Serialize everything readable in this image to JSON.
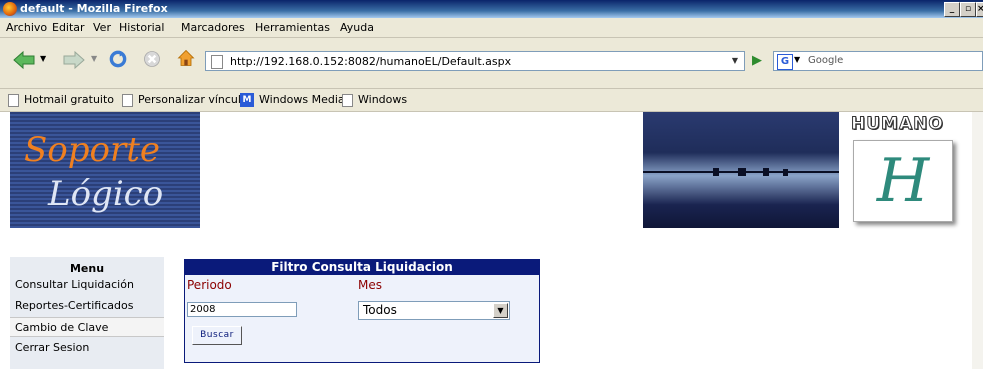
{
  "window": {
    "title": "default - Mozilla Firefox"
  },
  "menubar": [
    "Archivo",
    "Editar",
    "Ver",
    "Historial",
    "Marcadores",
    "Herramientas",
    "Ayuda"
  ],
  "navigation": {
    "url": "http://192.168.0.152:8082/humanoEL/Default.aspx",
    "search_placeholder": "Google"
  },
  "bookmarks": [
    "Hotmail gratuito",
    "Personalizar vínculos",
    "Windows Media",
    "Windows"
  ],
  "banner": {
    "logo_line1": "Soporte",
    "logo_line2": "Lógico",
    "brand": "HUMANO",
    "brand_mark": "H"
  },
  "sidebar": {
    "title": "Menu",
    "items": [
      "Consultar Liquidación",
      "Reportes-Certificados",
      "Cambio de Clave",
      "Cerrar Sesion"
    ]
  },
  "filter": {
    "title": "Filtro Consulta Liquidacion",
    "periodo_label": "Periodo",
    "periodo_value": "2008",
    "mes_label": "Mes",
    "mes_value": "Todos",
    "search_button": "Buscar"
  },
  "colors": {
    "header_bg": "#0a1a7a",
    "label_red": "#8b0000",
    "orange": "#f08020",
    "teal": "#2e8a7c"
  }
}
